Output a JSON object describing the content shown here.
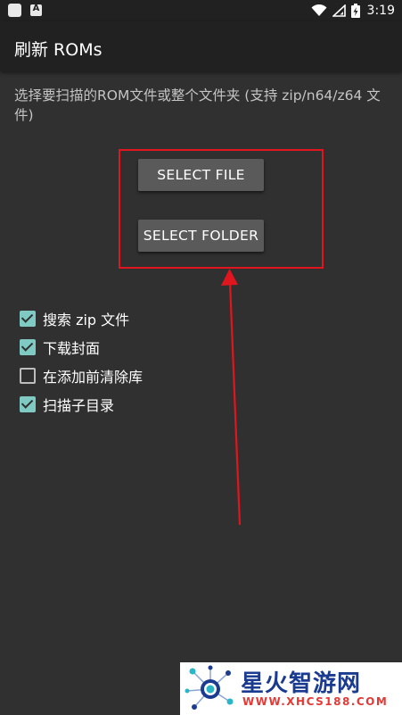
{
  "status_bar": {
    "time": "3:19",
    "icons": [
      "app-icon",
      "a-icon",
      "wifi-icon",
      "signal-icon",
      "battery-charging-icon"
    ]
  },
  "app_bar": {
    "title": "刷新 ROMs"
  },
  "main": {
    "description": "选择要扫描的ROM文件或整个文件夹 (支持 zip/n64/z64 文件)",
    "select_file_label": "SELECT FILE",
    "select_folder_label": "SELECT FOLDER",
    "options": [
      {
        "label": "搜索 zip 文件",
        "checked": true
      },
      {
        "label": "下载封面",
        "checked": true
      },
      {
        "label": "在添加前清除库",
        "checked": false
      },
      {
        "label": "扫描子目录",
        "checked": true
      }
    ]
  },
  "annotation": {
    "highlight_color": "#e0151d"
  },
  "watermark": {
    "text": "星火智游网",
    "url": "WWW.XHCS188.COM"
  },
  "colors": {
    "background": "#303030",
    "app_bar": "#212121",
    "checkbox_accent": "#7fcbc4",
    "button": "#5a5a5a"
  }
}
